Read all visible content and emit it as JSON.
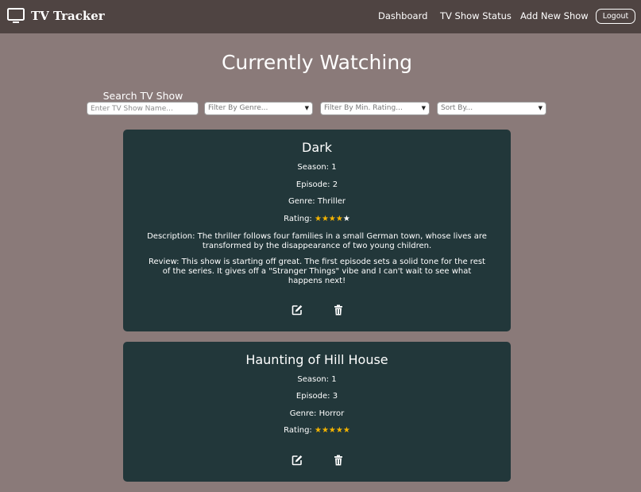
{
  "navbar": {
    "brand": "TV Tracker",
    "brand_icon": "tv-icon",
    "links": [
      "Dashboard",
      "TV Show Status",
      "Add New Show"
    ],
    "logout": "Logout"
  },
  "main": {
    "title": "Currently Watching",
    "search_label": "Search TV Show",
    "search_placeholder": "Enter TV Show Name...",
    "filter_genre": "Filter By Genre...",
    "filter_rating": "Filter By Min. Rating...",
    "sort_by": "Sort By..."
  },
  "shows": [
    {
      "title": "Dark",
      "season": "Season: 1",
      "episode": "Episode: 2",
      "genre": "Genre: Thriller",
      "rating_label": "Rating:",
      "rating": 4,
      "rating_max": 5,
      "description": "Description: The thriller follows four families in a small German town, whose lives are transformed by the disappearance of two young children.",
      "review": "Review: This show is starting off great. The first episode sets a solid tone for the rest of the series. It gives off a \"Stranger Things\" vibe and I can't wait to see what happens next!"
    },
    {
      "title": "Haunting of Hill House",
      "season": "Season: 1",
      "episode": "Episode: 3",
      "genre": "Genre: Horror",
      "rating_label": "Rating:",
      "rating": 5,
      "rating_max": 5
    }
  ],
  "colors": {
    "background": "#8a7a79",
    "navbar": "#4f4442",
    "card": "#22373a",
    "star": "#f5b400"
  },
  "icons": {
    "edit": "edit-icon",
    "delete": "trash-icon"
  }
}
